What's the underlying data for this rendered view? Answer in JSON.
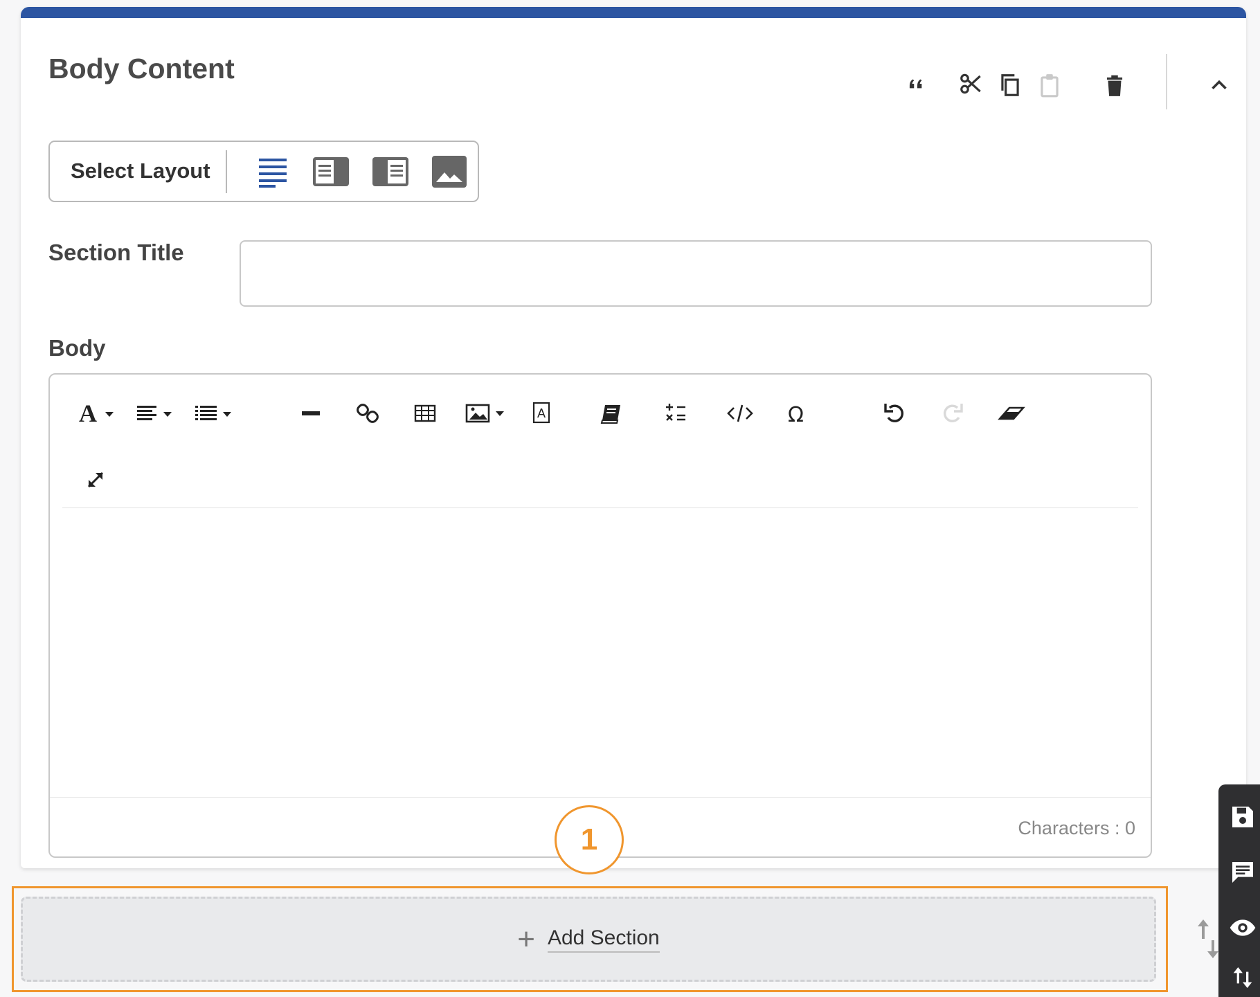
{
  "card": {
    "title": "Body Content",
    "tools": {
      "quote_icon": "quote-icon",
      "cut_icon": "scissors-icon",
      "copy_icon": "copy-icon",
      "paste_icon": "clipboard-icon",
      "delete_icon": "trash-icon",
      "collapse_icon": "chevron-up-icon"
    }
  },
  "layout": {
    "label": "Select Layout",
    "options": [
      "text-only",
      "image-left",
      "image-right",
      "image-only"
    ],
    "selected": "text-only"
  },
  "section_title": {
    "label": "Section Title",
    "value": "",
    "placeholder": ""
  },
  "body": {
    "label": "Body",
    "toolbar": [
      "font-style",
      "align",
      "list",
      "horizontal-rule",
      "link",
      "table",
      "image",
      "text-box",
      "glossary",
      "math",
      "code",
      "special-char",
      "undo",
      "redo",
      "clear-format",
      "fullscreen"
    ],
    "characters_label": "Characters : 0"
  },
  "callout": {
    "number": "1"
  },
  "add_section": {
    "plus": "+",
    "label": "Add Section"
  },
  "dock": [
    "save-icon",
    "comment-icon",
    "preview-icon",
    "reorder-icon"
  ],
  "colors": {
    "accent": "#2c55a2",
    "highlight": "#f0962e",
    "dock": "#2f2f31"
  }
}
